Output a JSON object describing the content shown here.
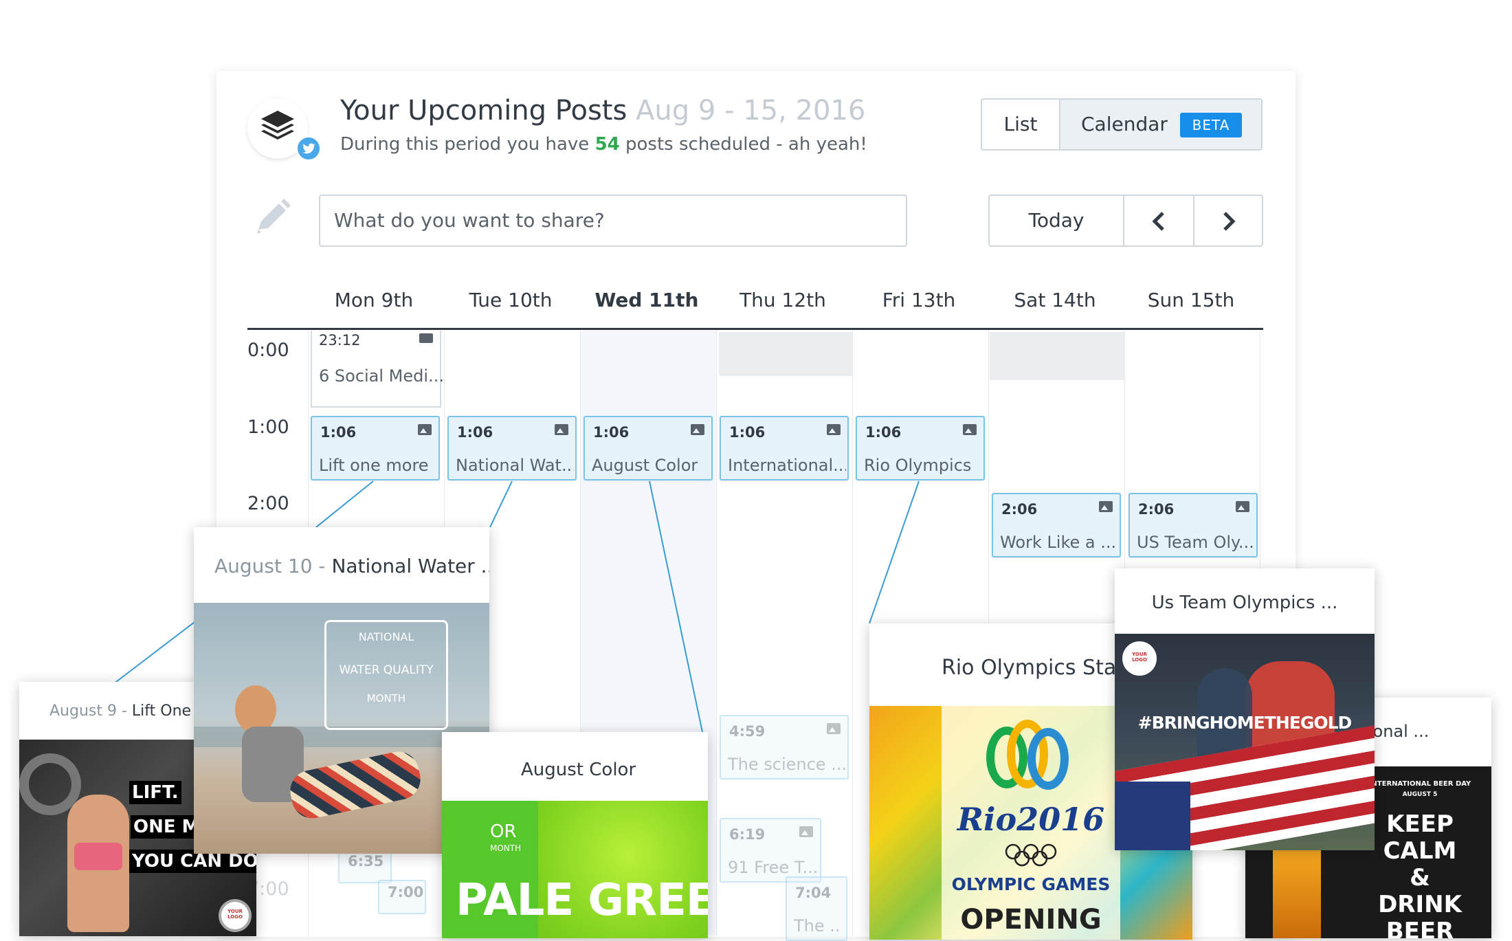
{
  "header": {
    "title": "Your Upcoming Posts",
    "date_range": "Aug 9 - 15, 2016",
    "subtitle_before": "During this period you have",
    "post_count": "54",
    "subtitle_after": "posts scheduled - ah yeah!"
  },
  "view_toggle": {
    "list_label": "List",
    "calendar_label": "Calendar",
    "beta_badge": "BETA"
  },
  "composer": {
    "placeholder": "What do you want to share?"
  },
  "navigation": {
    "today_label": "Today"
  },
  "days": [
    {
      "label": "Mon 9th"
    },
    {
      "label": "Tue 10th"
    },
    {
      "label": "Wed 11th"
    },
    {
      "label": "Thu 12th"
    },
    {
      "label": "Fri 13th"
    },
    {
      "label": "Sat 14th"
    },
    {
      "label": "Sun 15th"
    }
  ],
  "times": [
    "0:00",
    "1:00",
    "2:00",
    "7:00"
  ],
  "posts": {
    "mon_late": {
      "time": "23:12",
      "title": "6 Social Medi..."
    },
    "mon": {
      "time": "1:06",
      "title": "Lift one more"
    },
    "tue": {
      "time": "1:06",
      "title": "National Wat..."
    },
    "wed": {
      "time": "1:06",
      "title": "August Color"
    },
    "thu": {
      "time": "1:06",
      "title": "International..."
    },
    "fri": {
      "time": "1:06",
      "title": "Rio Olympics"
    },
    "sat": {
      "time": "2:06",
      "title": "Work Like a ..."
    },
    "sun": {
      "time": "2:06",
      "title": "US Team Oly..."
    },
    "thu_459": {
      "time": "4:59",
      "title": "The science ..."
    },
    "thu_619": {
      "time": "6:19",
      "title": "91 Free T..."
    },
    "thu_704": {
      "time": "7:04",
      "title": "The ..."
    },
    "mon_635": {
      "time": "6:35"
    },
    "mon_700": {
      "time": "7:00"
    }
  },
  "cards": {
    "lift": {
      "date": "August 9 -",
      "title": "Lift One Mo",
      "img_lines": [
        "LIFT.",
        "ONE MOR",
        "YOU CAN DO IT!"
      ]
    },
    "water": {
      "date": "August 10 -",
      "title": "National Water ...",
      "badge_top": "NATIONAL",
      "badge_mid": "WATER QUALITY",
      "badge_bottom": "MONTH"
    },
    "color": {
      "title": "August Color",
      "img_text": "PALE GREEN",
      "img_small": "OR",
      "img_small2": "MONTH"
    },
    "rio": {
      "title": "Rio Olympics Star",
      "img_brand": "Rio2016",
      "img_sub": "OLYMPIC GAMES",
      "img_sub2": "OPENING"
    },
    "us": {
      "title": "Us Team Olympics ...",
      "img_hashtag": "#BRINGHOMETHEGOLD"
    },
    "intl": {
      "title": "nternational ...",
      "img_small1": "INTERNATIONAL BEER DAY",
      "img_small2": "AUGUST 5",
      "img_lines": [
        "KEEP",
        "CALM",
        "&",
        "DRINK",
        "BEER"
      ]
    }
  },
  "brand_logo_text": "YOUR LOGO",
  "colors": {
    "accent": "#168eea",
    "post_bg": "#e6f3fb",
    "post_border": "#7cc3e9",
    "success": "#2fa84f"
  }
}
